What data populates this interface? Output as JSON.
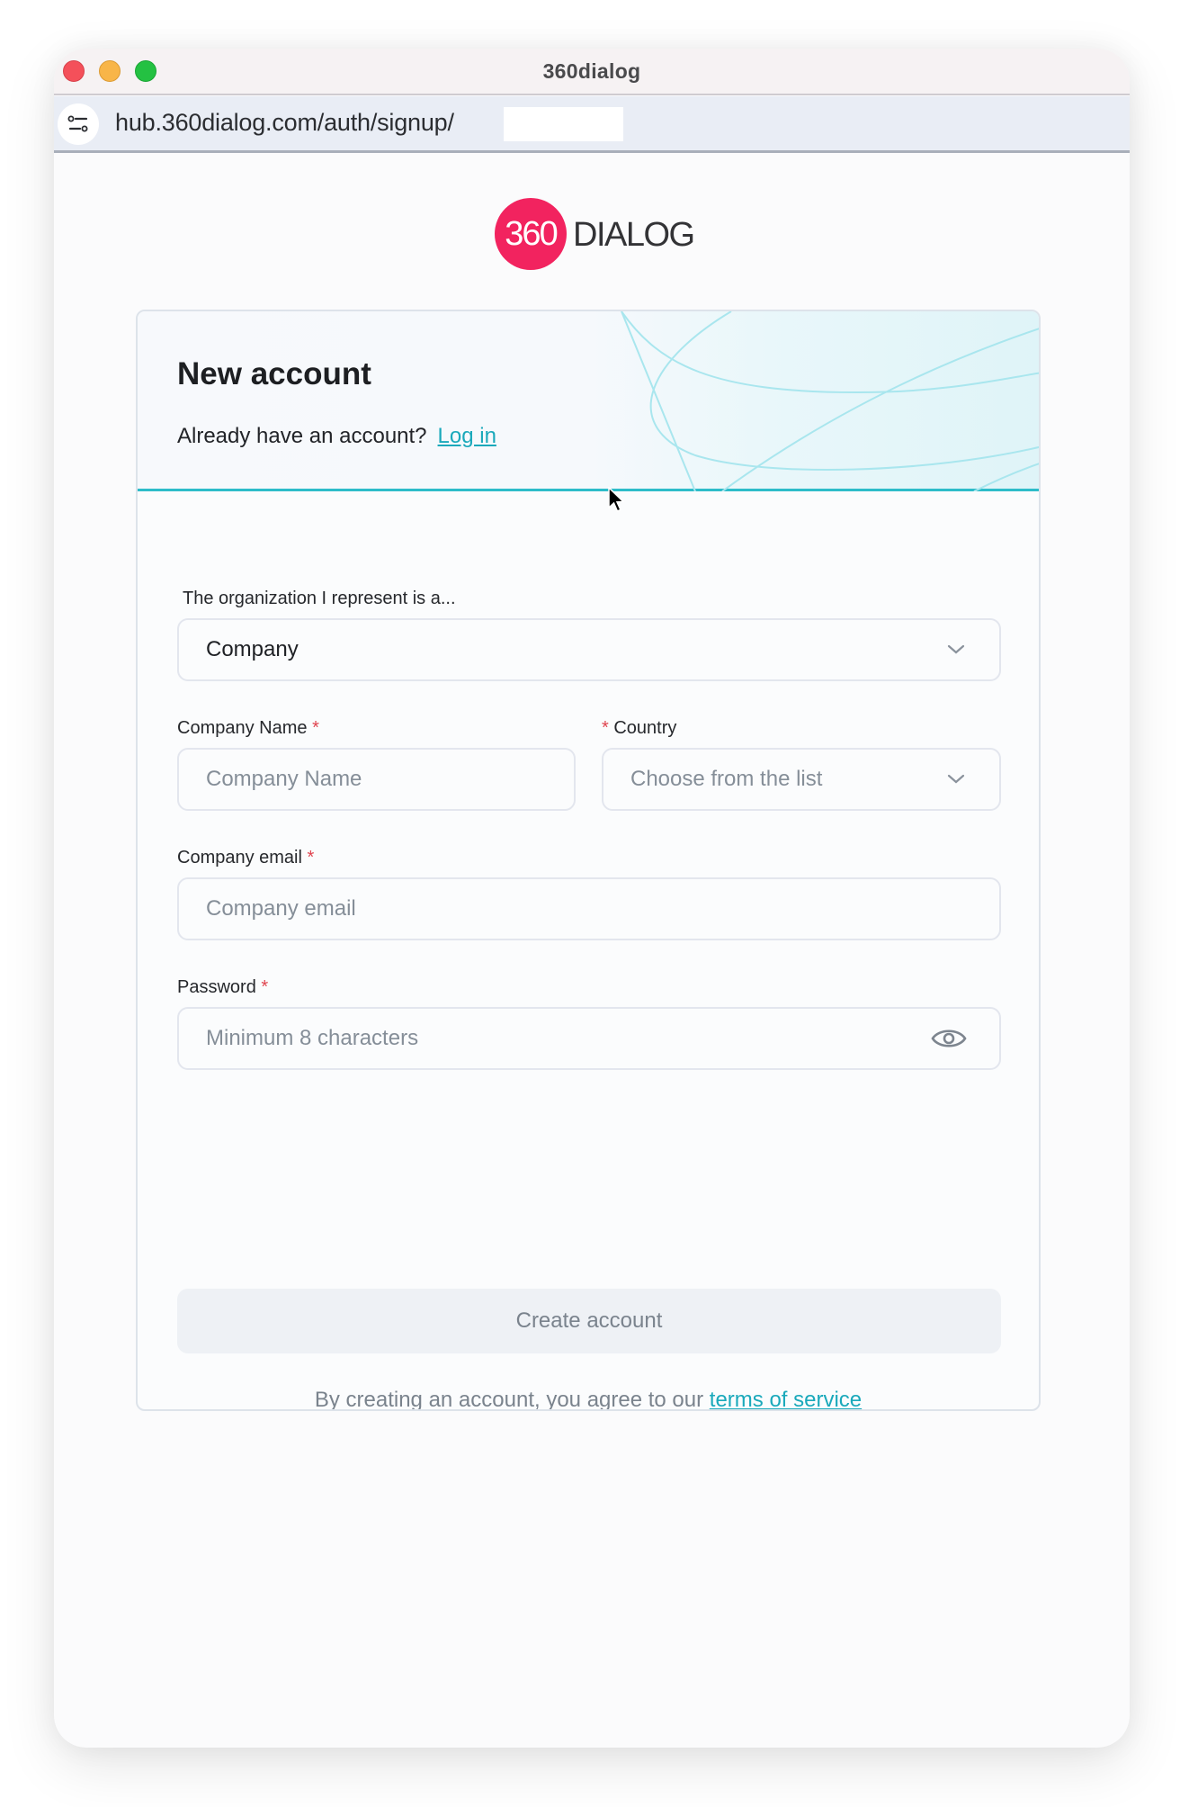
{
  "window": {
    "title": "360dialog",
    "traffic_lights": [
      "close",
      "minimize",
      "maximize"
    ]
  },
  "address_bar": {
    "url": "hub.360dialog.com/auth/signup/",
    "site_settings_icon": "tune-icon"
  },
  "logo": {
    "mark": "360",
    "word": "DIALOG",
    "brand_color": "#f2235f"
  },
  "header": {
    "title": "New account",
    "prompt": "Already have an account?",
    "login_link": "Log in",
    "accent_color": "#2dbcc9"
  },
  "form": {
    "org_type": {
      "label": "The organization I represent is a...",
      "value": "Company"
    },
    "company_name": {
      "label": "Company Name",
      "required_mark": "*",
      "placeholder": "Company Name"
    },
    "country": {
      "label": "Country",
      "required_mark": "*",
      "placeholder": "Choose from the list"
    },
    "company_email": {
      "label": "Company email",
      "required_mark": "*",
      "placeholder": "Company email"
    },
    "password": {
      "label": "Password",
      "required_mark": "*",
      "placeholder": "Minimum 8 characters",
      "toggle_icon": "eye-icon"
    },
    "submit_label": "Create account",
    "terms_prefix": "By creating an account, you agree to our ",
    "terms_link": "terms of service"
  }
}
